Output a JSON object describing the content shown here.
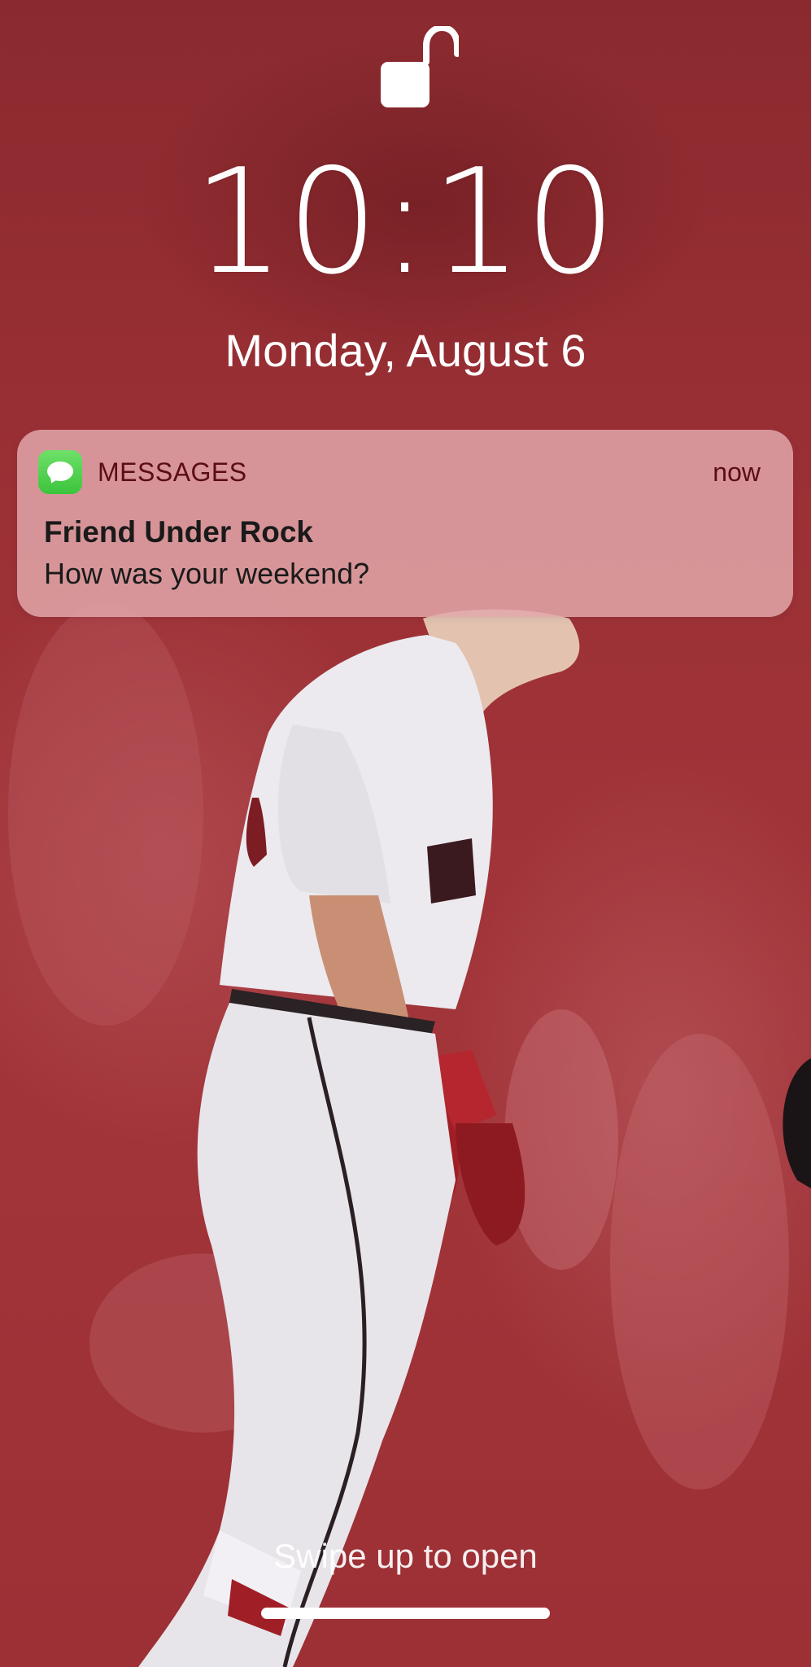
{
  "lock_screen": {
    "time": "10:10",
    "date": "Monday, August 6",
    "lock_state_icon": "unlocked-padlock-icon"
  },
  "notification": {
    "app_icon": "messages-icon",
    "app_name": "MESSAGES",
    "time": "now",
    "title": "Friend Under Rock",
    "body": "How was your weekend?",
    "icon_color": "#4cd44a"
  },
  "footer": {
    "swipe_hint": "Swipe up to open"
  },
  "colors": {
    "wallpaper_base": "#9b3035",
    "notification_bg": "#e2a8ac",
    "notification_accent_text": "#5b0d14"
  }
}
